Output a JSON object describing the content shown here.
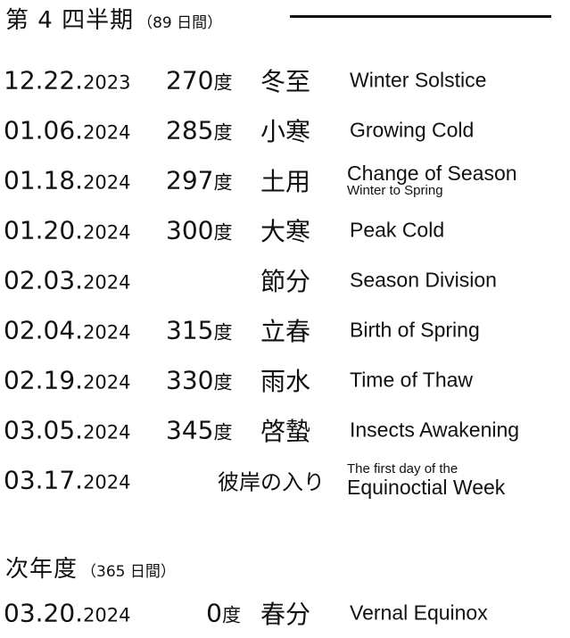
{
  "quarter_header": {
    "title": "第 4 四半期",
    "note": "（89 日間）"
  },
  "quarter_rows": [
    {
      "date": "12.22.",
      "year": "2023",
      "degree": "270",
      "degree_unit": "度",
      "term": "冬至",
      "english": "Winter Solstice"
    },
    {
      "date": "01.06.",
      "year": "2024",
      "degree": "285",
      "degree_unit": "度",
      "term": "小寒",
      "english": "Growing Cold"
    },
    {
      "date": "01.18.",
      "year": "2024",
      "degree": "297",
      "degree_unit": "度",
      "term": "土用",
      "english": "Change of Season",
      "english_sub": "Winter to Spring"
    },
    {
      "date": "01.20.",
      "year": "2024",
      "degree": "300",
      "degree_unit": "度",
      "term": "大寒",
      "english": "Peak Cold"
    },
    {
      "date": "02.03.",
      "year": "2024",
      "term": "節分",
      "english": "Season Division"
    },
    {
      "date": "02.04.",
      "year": "2024",
      "degree": "315",
      "degree_unit": "度",
      "term": "立春",
      "english": "Birth of Spring"
    },
    {
      "date": "02.19.",
      "year": "2024",
      "degree": "330",
      "degree_unit": "度",
      "term": "雨水",
      "english": "Time of Thaw"
    },
    {
      "date": "03.05.",
      "year": "2024",
      "degree": "345",
      "degree_unit": "度",
      "term": "啓蟄",
      "english": "Insects Awakening"
    },
    {
      "date": "03.17.",
      "year": "2024",
      "term": "彼岸の入り",
      "english_pre": "The first day of the",
      "english": "Equinoctial Week"
    }
  ],
  "next_year_header": {
    "title": "次年度",
    "note": "（365 日間）"
  },
  "next_year_rows": [
    {
      "date": "03.20.",
      "year": "2024",
      "degree": "0",
      "degree_unit": "度",
      "term": "春分",
      "english": "Vernal Equinox"
    }
  ]
}
